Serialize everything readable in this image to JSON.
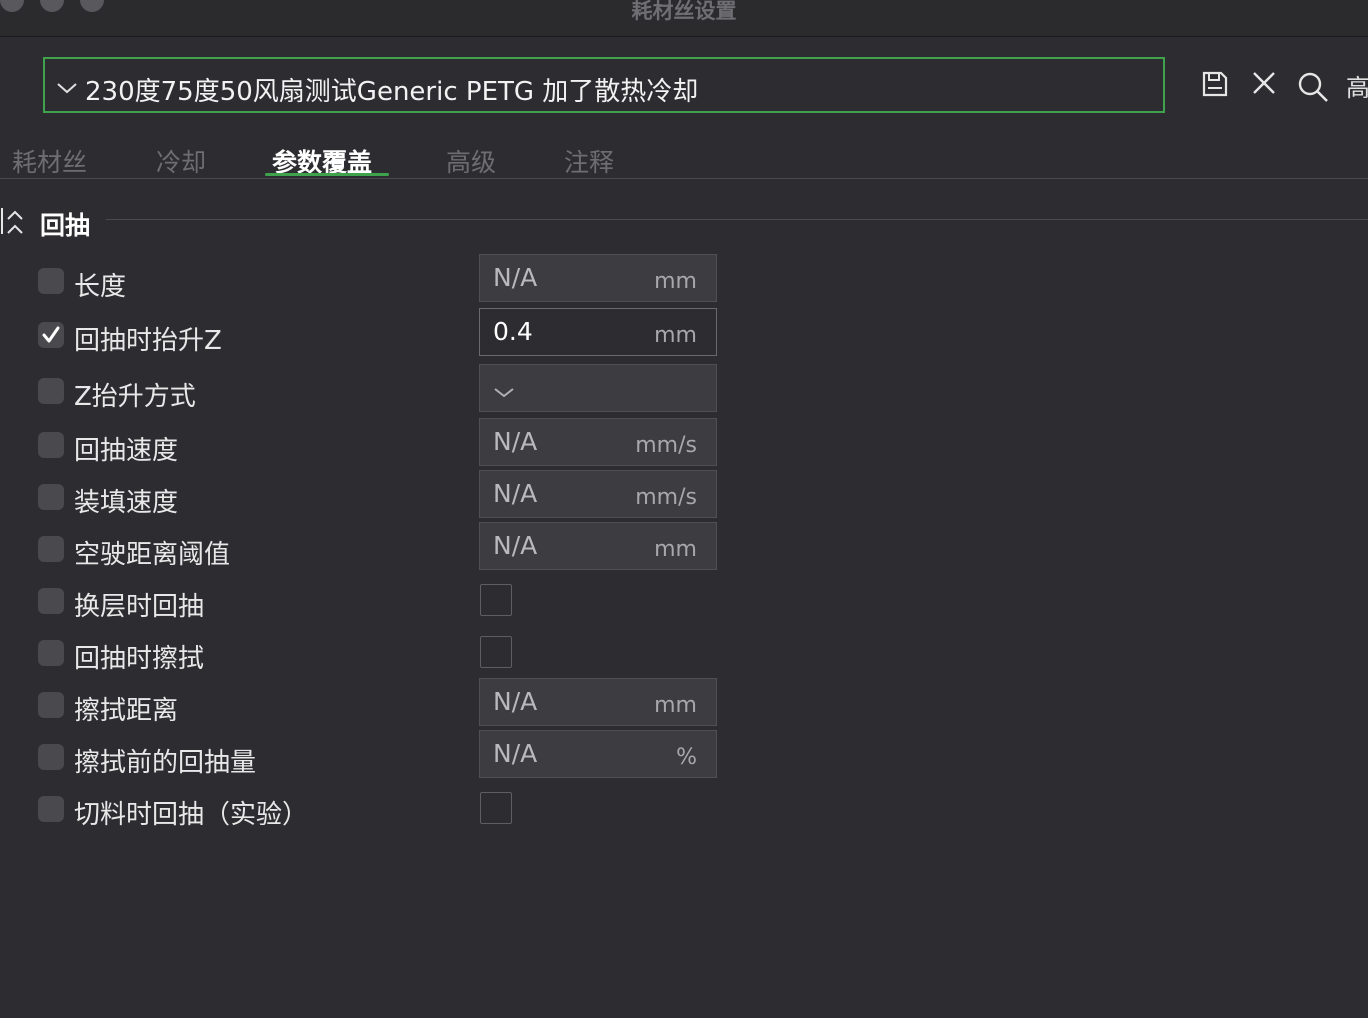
{
  "window": {
    "title": "耗材丝设置"
  },
  "preset": {
    "name": "230度75度50风扇测试Generic PETG 加了散热冷却",
    "partial_label": "高"
  },
  "toolbar": {
    "icons": [
      "save-icon",
      "close-icon",
      "search-icon"
    ]
  },
  "tabs": [
    {
      "label": "耗材丝",
      "active": false
    },
    {
      "label": "冷却",
      "active": false
    },
    {
      "label": "参数覆盖",
      "active": true
    },
    {
      "label": "高级",
      "active": false
    },
    {
      "label": "注释",
      "active": false
    }
  ],
  "section": {
    "title": "回抽"
  },
  "rows": [
    {
      "label": "长度",
      "checked": false,
      "type": "text",
      "value": "N/A",
      "unit": "mm"
    },
    {
      "label": "回抽时抬升Z",
      "checked": true,
      "type": "text",
      "value": "0.4",
      "unit": "mm"
    },
    {
      "label": "Z抬升方式",
      "checked": false,
      "type": "dropdown",
      "value": "",
      "unit": ""
    },
    {
      "label": "回抽速度",
      "checked": false,
      "type": "text",
      "value": "N/A",
      "unit": "mm/s"
    },
    {
      "label": "装填速度",
      "checked": false,
      "type": "text",
      "value": "N/A",
      "unit": "mm/s"
    },
    {
      "label": "空驶距离阈值",
      "checked": false,
      "type": "text",
      "value": "N/A",
      "unit": "mm"
    },
    {
      "label": "换层时回抽",
      "checked": false,
      "type": "checkbox"
    },
    {
      "label": "回抽时擦拭",
      "checked": false,
      "type": "checkbox"
    },
    {
      "label": "擦拭距离",
      "checked": false,
      "type": "text",
      "value": "N/A",
      "unit": "mm"
    },
    {
      "label": "擦拭前的回抽量",
      "checked": false,
      "type": "text",
      "value": "N/A",
      "unit": "%"
    },
    {
      "label": "切料时回抽（实验）",
      "checked": false,
      "type": "checkbox"
    }
  ],
  "colors": {
    "accent": "#3fa34d",
    "background": "#2d2d31"
  }
}
